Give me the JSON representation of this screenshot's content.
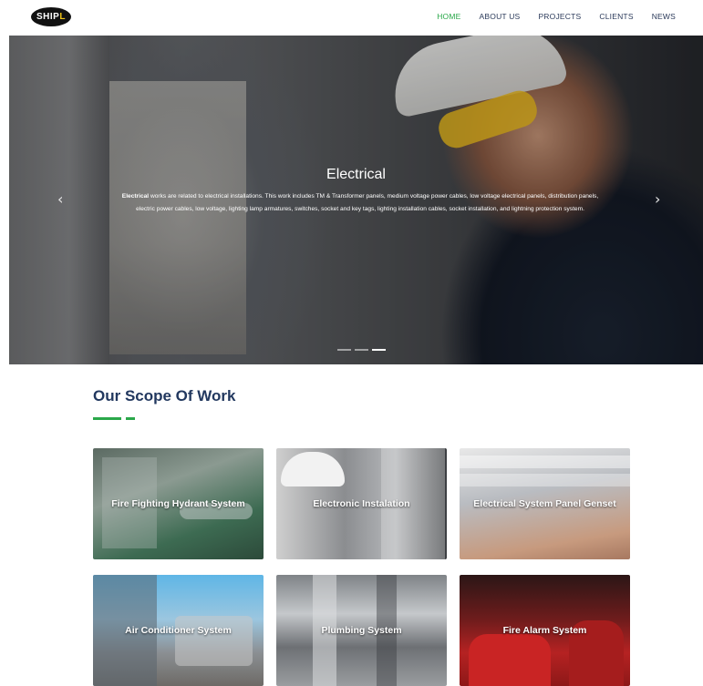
{
  "brand": {
    "logo_text_main": "SHIP",
    "logo_text_accent": "L"
  },
  "nav": {
    "items": [
      {
        "label": "HOME",
        "active": true
      },
      {
        "label": "ABOUT US",
        "active": false
      },
      {
        "label": "PROJECTS",
        "active": false
      },
      {
        "label": "CLIENTS",
        "active": false
      },
      {
        "label": "NEWS",
        "active": false
      }
    ]
  },
  "hero": {
    "title": "Electrical",
    "description_bold": "Electrical",
    "description": " works are related to electrical installations. This work includes TM & Transformer panels, medium voltage power cables, low voltage electrical panels, distribution panels, electric power cables, low voltage, lighting lamp armatures, switches, socket and key tags, lighting installation cables, socket installation, and lightning protection system.",
    "prev_icon": "chevron-left-icon",
    "next_icon": "chevron-right-icon",
    "slides_count": 3,
    "active_slide": 3
  },
  "scope": {
    "title": "Our Scope Of Work",
    "accent_color": "#2aa84a",
    "cards": [
      {
        "label": "Fire Fighting Hydrant System"
      },
      {
        "label": "Electronic Instalation"
      },
      {
        "label": "Electrical System Panel Genset"
      },
      {
        "label": "Air Conditioner System"
      },
      {
        "label": "Plumbing System"
      },
      {
        "label": "Fire Alarm System"
      }
    ]
  }
}
